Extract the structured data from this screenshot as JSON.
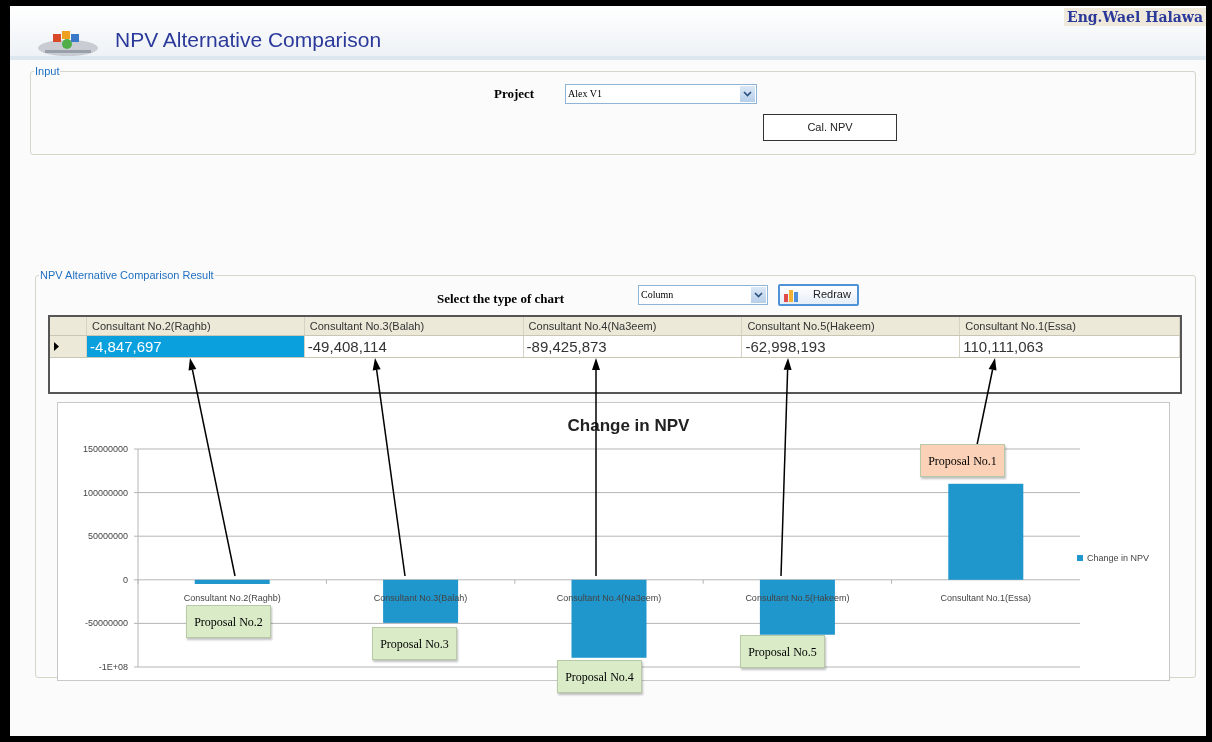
{
  "window": {
    "title": "NPV Alternative Comparison",
    "author": "Eng.Wael Halawa"
  },
  "input": {
    "title": "Input",
    "project_label": "Project",
    "project_value": "Alex V1",
    "calc_button": "Cal. NPV"
  },
  "result": {
    "title": "NPV Alternative Comparison Result",
    "chart_type_label": "Select the type of chart",
    "chart_type_value": "Column",
    "redraw_button": "Redraw",
    "grid": {
      "columns": [
        "Consultant No.2(Raghb)",
        "Consultant No.3(Balah)",
        "Consultant No.4(Na3eem)",
        "Consultant No.5(Hakeem)",
        "Consultant No.1(Essa)"
      ],
      "rows": [
        {
          "current": true,
          "cells": [
            {
              "text": "-4,847,697",
              "selected": true
            },
            {
              "text": "-49,408,114",
              "selected": false
            },
            {
              "text": "-89,425,873",
              "selected": false
            },
            {
              "text": "-62,998,193",
              "selected": false
            },
            {
              "text": "110,111,063",
              "selected": false
            }
          ]
        }
      ]
    },
    "chart": {
      "chart_data": {
        "type": "bar",
        "title": "Change in NPV",
        "categories": [
          "Consultant No.2(Raghb)",
          "Consultant No.3(Balah)",
          "Consultant No.4(Na3eem)",
          "Consultant No.5(Hakeem)",
          "Consultant No.1(Essa)"
        ],
        "series": [
          {
            "name": "Change in NPV",
            "color": "#1f96cc",
            "values": [
              -4800000,
              -49400000,
              -89400000,
              -63000000,
              110100000
            ]
          }
        ],
        "grid": true,
        "ylim": [
          -100000000,
          150000000
        ],
        "yticks": [
          {
            "value": 150000000,
            "label": "150000000"
          },
          {
            "value": 100000000,
            "label": "100000000"
          },
          {
            "value": 50000000,
            "label": "50000000"
          },
          {
            "value": 0,
            "label": "0"
          },
          {
            "value": -50000000,
            "label": "-50000000"
          },
          {
            "value": -100000000,
            "label": "-1E+08"
          }
        ]
      }
    },
    "callouts": [
      {
        "text": "Proposal No.2",
        "color": "#d9ecc7"
      },
      {
        "text": "Proposal No.3",
        "color": "#d9ecc7"
      },
      {
        "text": "Proposal No.4",
        "color": "#d9ecc7"
      },
      {
        "text": "Proposal No.5",
        "color": "#d9ecc7"
      },
      {
        "text": "Proposal No.1",
        "color": "#fbd2b8"
      }
    ]
  }
}
